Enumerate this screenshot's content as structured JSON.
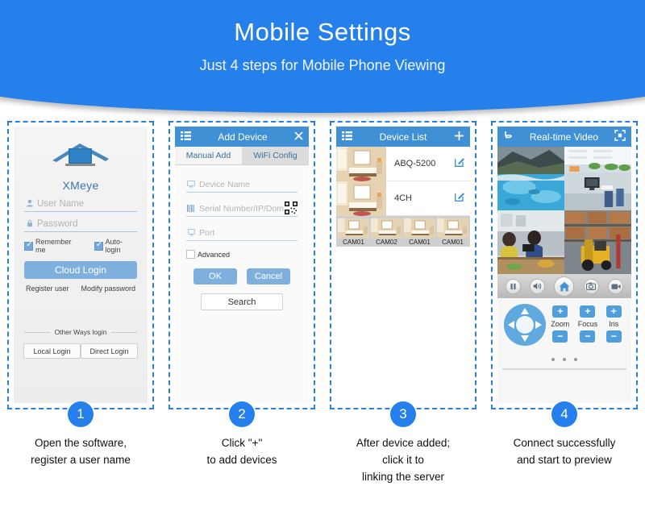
{
  "header": {
    "title": "Mobile Settings",
    "subtitle": "Just 4 steps for Mobile Phone Viewing",
    "bg_color": "#2680eb"
  },
  "steps": [
    {
      "number": "1",
      "caption_line1": "Open the software,",
      "caption_line2": "register a user name",
      "caption_line3": ""
    },
    {
      "number": "2",
      "caption_line1": "Click \"+\"",
      "caption_line2": "to add devices",
      "caption_line3": ""
    },
    {
      "number": "3",
      "caption_line1": "After device added;",
      "caption_line2": "click it to",
      "caption_line3": "linking the server"
    },
    {
      "number": "4",
      "caption_line1": "Connect successfully",
      "caption_line2": "and start to preview",
      "caption_line3": ""
    }
  ],
  "panel1": {
    "app_name": "XMeye",
    "logo_icon": "house-logo-icon",
    "username": {
      "placeholder": "User Name",
      "icon": "user-icon"
    },
    "password": {
      "placeholder": "Password",
      "icon": "lock-icon"
    },
    "remember_me": {
      "label": "Remember me",
      "checked": "true"
    },
    "auto_login": {
      "label": "Auto-login",
      "checked": "true"
    },
    "cloud_login": "Cloud Login",
    "register_user": "Register user",
    "modify_password": "Modify password",
    "other_ways": "Other Ways login",
    "local_login": "Local Login",
    "direct_login": "Direct Login"
  },
  "panel2": {
    "title": "Add Device",
    "menu_icon": "hamburger-menu-icon",
    "close_icon": "close-icon",
    "tab_manual": "Manual Add",
    "tab_wifi": "WiFi Config",
    "device_name": {
      "placeholder": "Device Name",
      "icon": "monitor-icon"
    },
    "serial": {
      "placeholder": "Serial Number/IP/Dom",
      "icon": "barcode-icon",
      "qr_icon": "qr-code-icon"
    },
    "port": {
      "placeholder": "Port",
      "icon": "port-icon"
    },
    "advanced": {
      "label": "Advanced",
      "checked": "false"
    },
    "ok": "OK",
    "cancel": "Cancel",
    "search": "Search"
  },
  "panel3": {
    "title": "Device List",
    "menu_icon": "hamburger-menu-icon",
    "add_icon": "plus-icon",
    "devices": [
      {
        "name": "ABQ-5200",
        "edit_icon": "edit-pencil-icon"
      },
      {
        "name": "4CH",
        "edit_icon": "edit-pencil-icon"
      }
    ],
    "cameras": [
      "CAM01",
      "CAM02",
      "CAM01",
      "CAM01"
    ]
  },
  "panel4": {
    "title": "Real-time Video",
    "back_icon": "back-arrow-icon",
    "fullscreen_icon": "fullscreen-icon",
    "controls": [
      {
        "name": "pause-button",
        "icon": "pause-icon"
      },
      {
        "name": "volume-button",
        "icon": "speaker-icon"
      },
      {
        "name": "home-button",
        "icon": "home-icon"
      },
      {
        "name": "snapshot-button",
        "icon": "camera-icon"
      },
      {
        "name": "record-button",
        "icon": "video-camera-icon"
      }
    ],
    "dpad_icon": "direction-pad-icon",
    "adjusters": [
      {
        "label": "Zoom",
        "plus": "+",
        "minus": "−"
      },
      {
        "label": "Focus",
        "plus": "+",
        "minus": "−"
      },
      {
        "label": "Iris",
        "plus": "+",
        "minus": "−"
      }
    ],
    "page_dots": 3
  },
  "colors": {
    "brand_blue": "#2680eb",
    "bar_blue": "#3f90d4",
    "button_blue": "#7fb0dd",
    "accent_blue": "#4f9fdd"
  }
}
